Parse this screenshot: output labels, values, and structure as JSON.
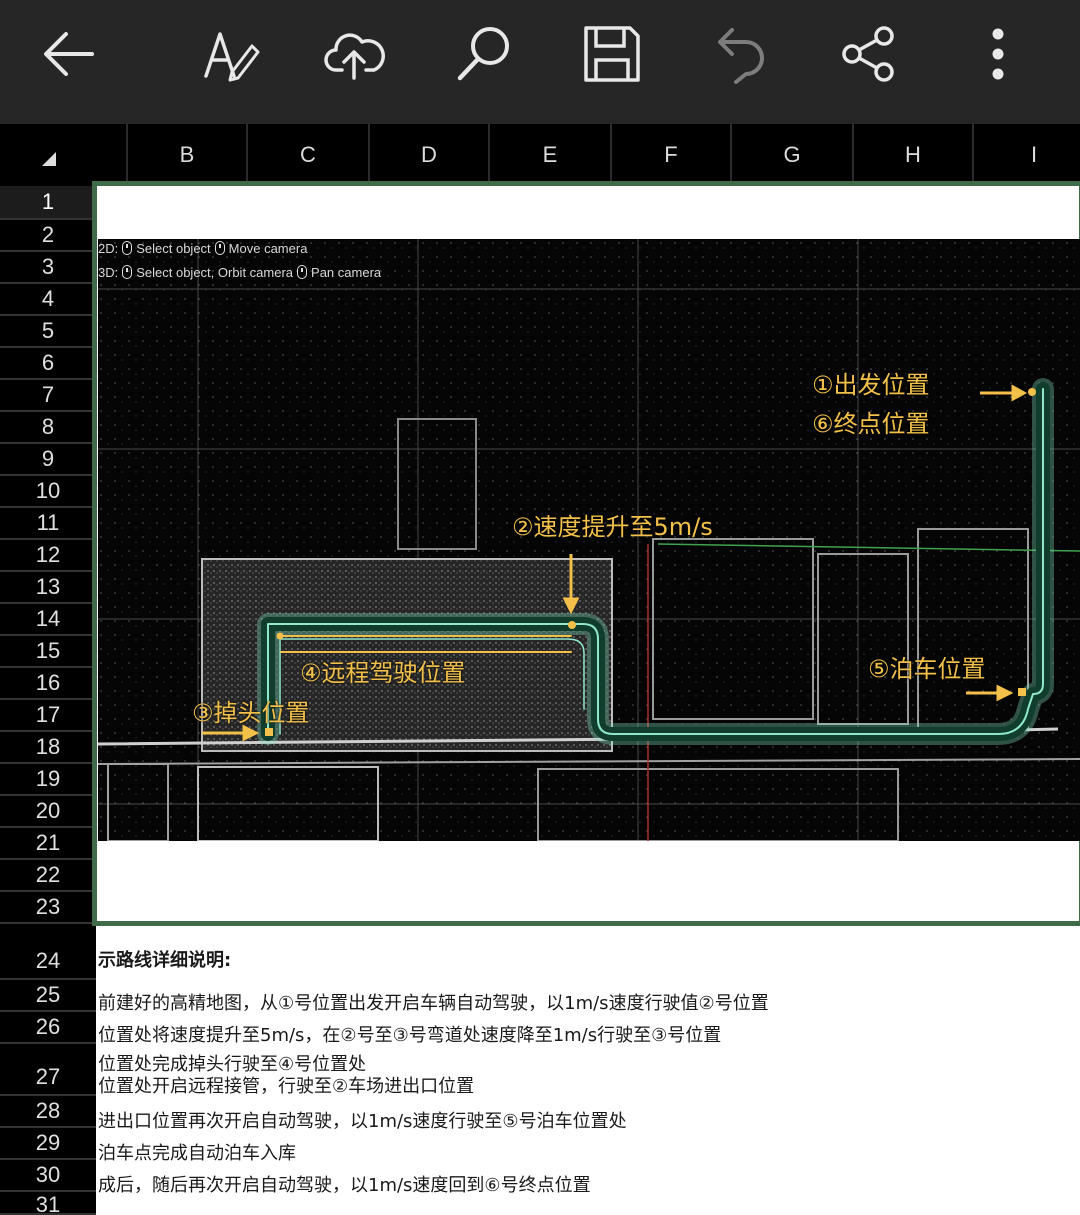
{
  "toolbar": {
    "buttons": [
      {
        "name": "back-button",
        "icon": "arrow-left-icon"
      },
      {
        "name": "edit-text-button",
        "icon": "text-pen-icon"
      },
      {
        "name": "upload-button",
        "icon": "cloud-upload-icon"
      },
      {
        "name": "search-button",
        "icon": "search-icon"
      },
      {
        "name": "save-button",
        "icon": "floppy-disk-icon"
      },
      {
        "name": "undo-button",
        "icon": "undo-icon"
      },
      {
        "name": "share-button",
        "icon": "share-icon"
      },
      {
        "name": "more-button",
        "icon": "more-vertical-icon"
      }
    ]
  },
  "sheet": {
    "columns": [
      "B",
      "C",
      "D",
      "E",
      "F",
      "G",
      "H",
      "I"
    ],
    "rows": [
      "1",
      "2",
      "3",
      "4",
      "5",
      "6",
      "7",
      "8",
      "9",
      "10",
      "11",
      "12",
      "13",
      "14",
      "15",
      "16",
      "17",
      "18",
      "19",
      "20",
      "21",
      "22",
      "23",
      "24",
      "25",
      "26",
      "27",
      "28",
      "29",
      "30",
      "31"
    ],
    "selected_row": "1"
  },
  "map_image": {
    "hint_2d_prefix": "2D:",
    "hint_2d_a": "Select object",
    "hint_2d_b": "Move camera",
    "hint_3d_prefix": "3D:",
    "hint_3d_a": "Select object, Orbit camera",
    "hint_3d_b": "Pan camera",
    "label_start": "①出发位置",
    "label_end": "⑥终点位置",
    "label_speed": "②速度提升至5m/s",
    "label_remote": "④远程驾驶位置",
    "label_uturn": "③掉头位置",
    "label_park": "⑤泊车位置",
    "annotation_color": "#f3c04a",
    "route_color": "#7fe0c0"
  },
  "notes": {
    "heading": "示路线详细说明:",
    "lines": [
      "前建好的高精地图，从①号位置出发开启车辆自动驾驶，以1m/s速度行驶值②号位置",
      "位置处将速度提升至5m/s，在②号至③号弯道处速度降至1m/s行驶至③号位置",
      "位置处完成掉头行驶至④号位置处",
      "位置处开启远程接管，行驶至②车场进出口位置",
      "进出口位置再次开启自动驾驶，以1m/s速度行驶至⑤号泊车位置处",
      "泊车点完成自动泊车入库",
      "成后，随后再次开启自动驾驶，以1m/s速度回到⑥号终点位置"
    ]
  }
}
